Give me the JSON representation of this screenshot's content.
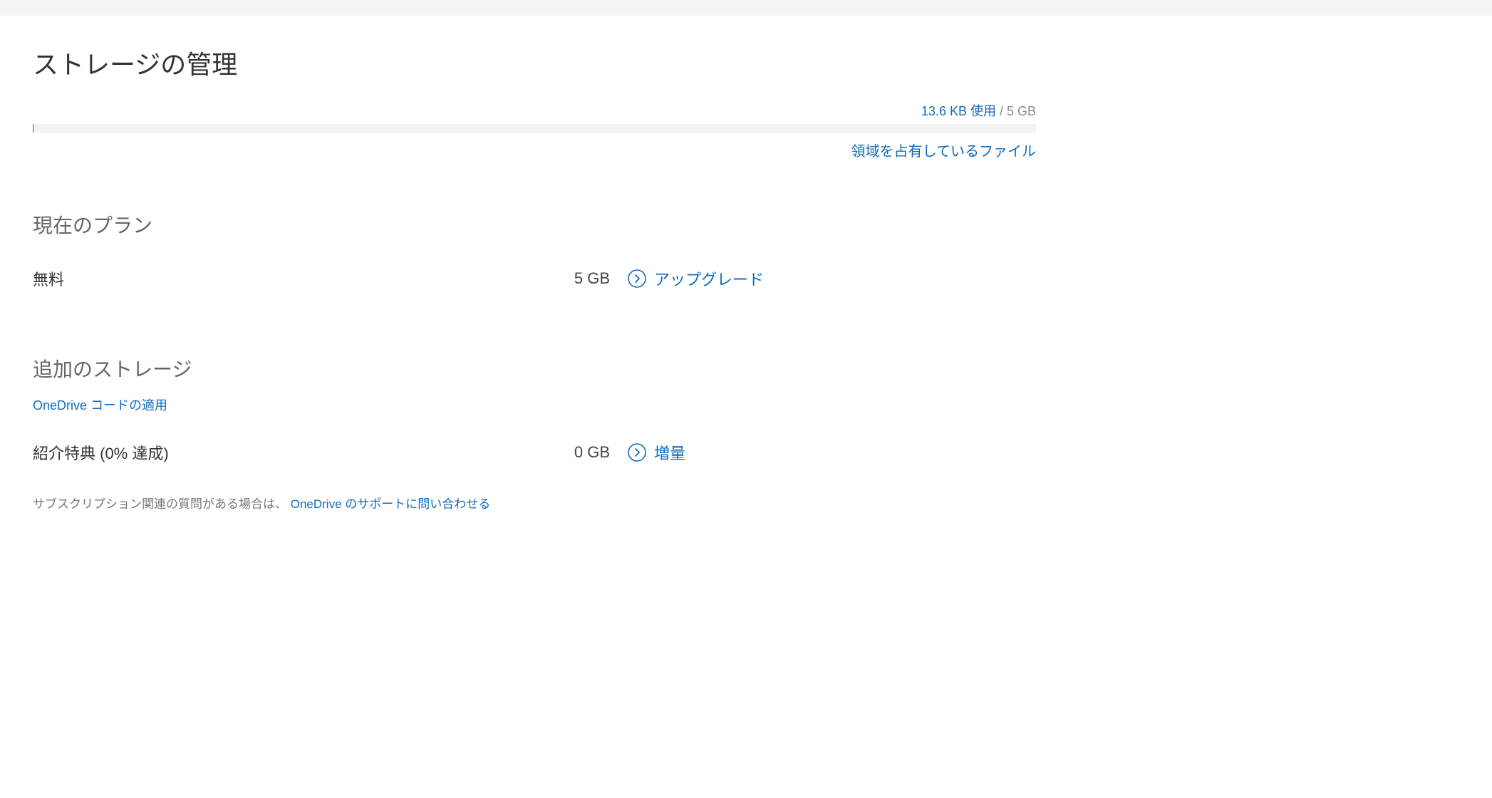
{
  "page": {
    "title": "ストレージの管理"
  },
  "usage": {
    "used_text": "13.6 KB 使用",
    "total_text": " / 5 GB",
    "files_link": "領域を占有しているファイル"
  },
  "current_plan": {
    "heading": "現在のプラン",
    "name": "無料",
    "size": "5 GB",
    "action": "アップグレード"
  },
  "additional": {
    "heading": "追加のストレージ",
    "code_link": "OneDrive コードの適用",
    "bonus_name": "紹介特典 (0% 達成)",
    "bonus_size": "0 GB",
    "bonus_action": "増量"
  },
  "footer": {
    "prefix": "サブスクリプション関連の質問がある場合は、 ",
    "link": "OneDrive のサポートに問い合わせる"
  }
}
